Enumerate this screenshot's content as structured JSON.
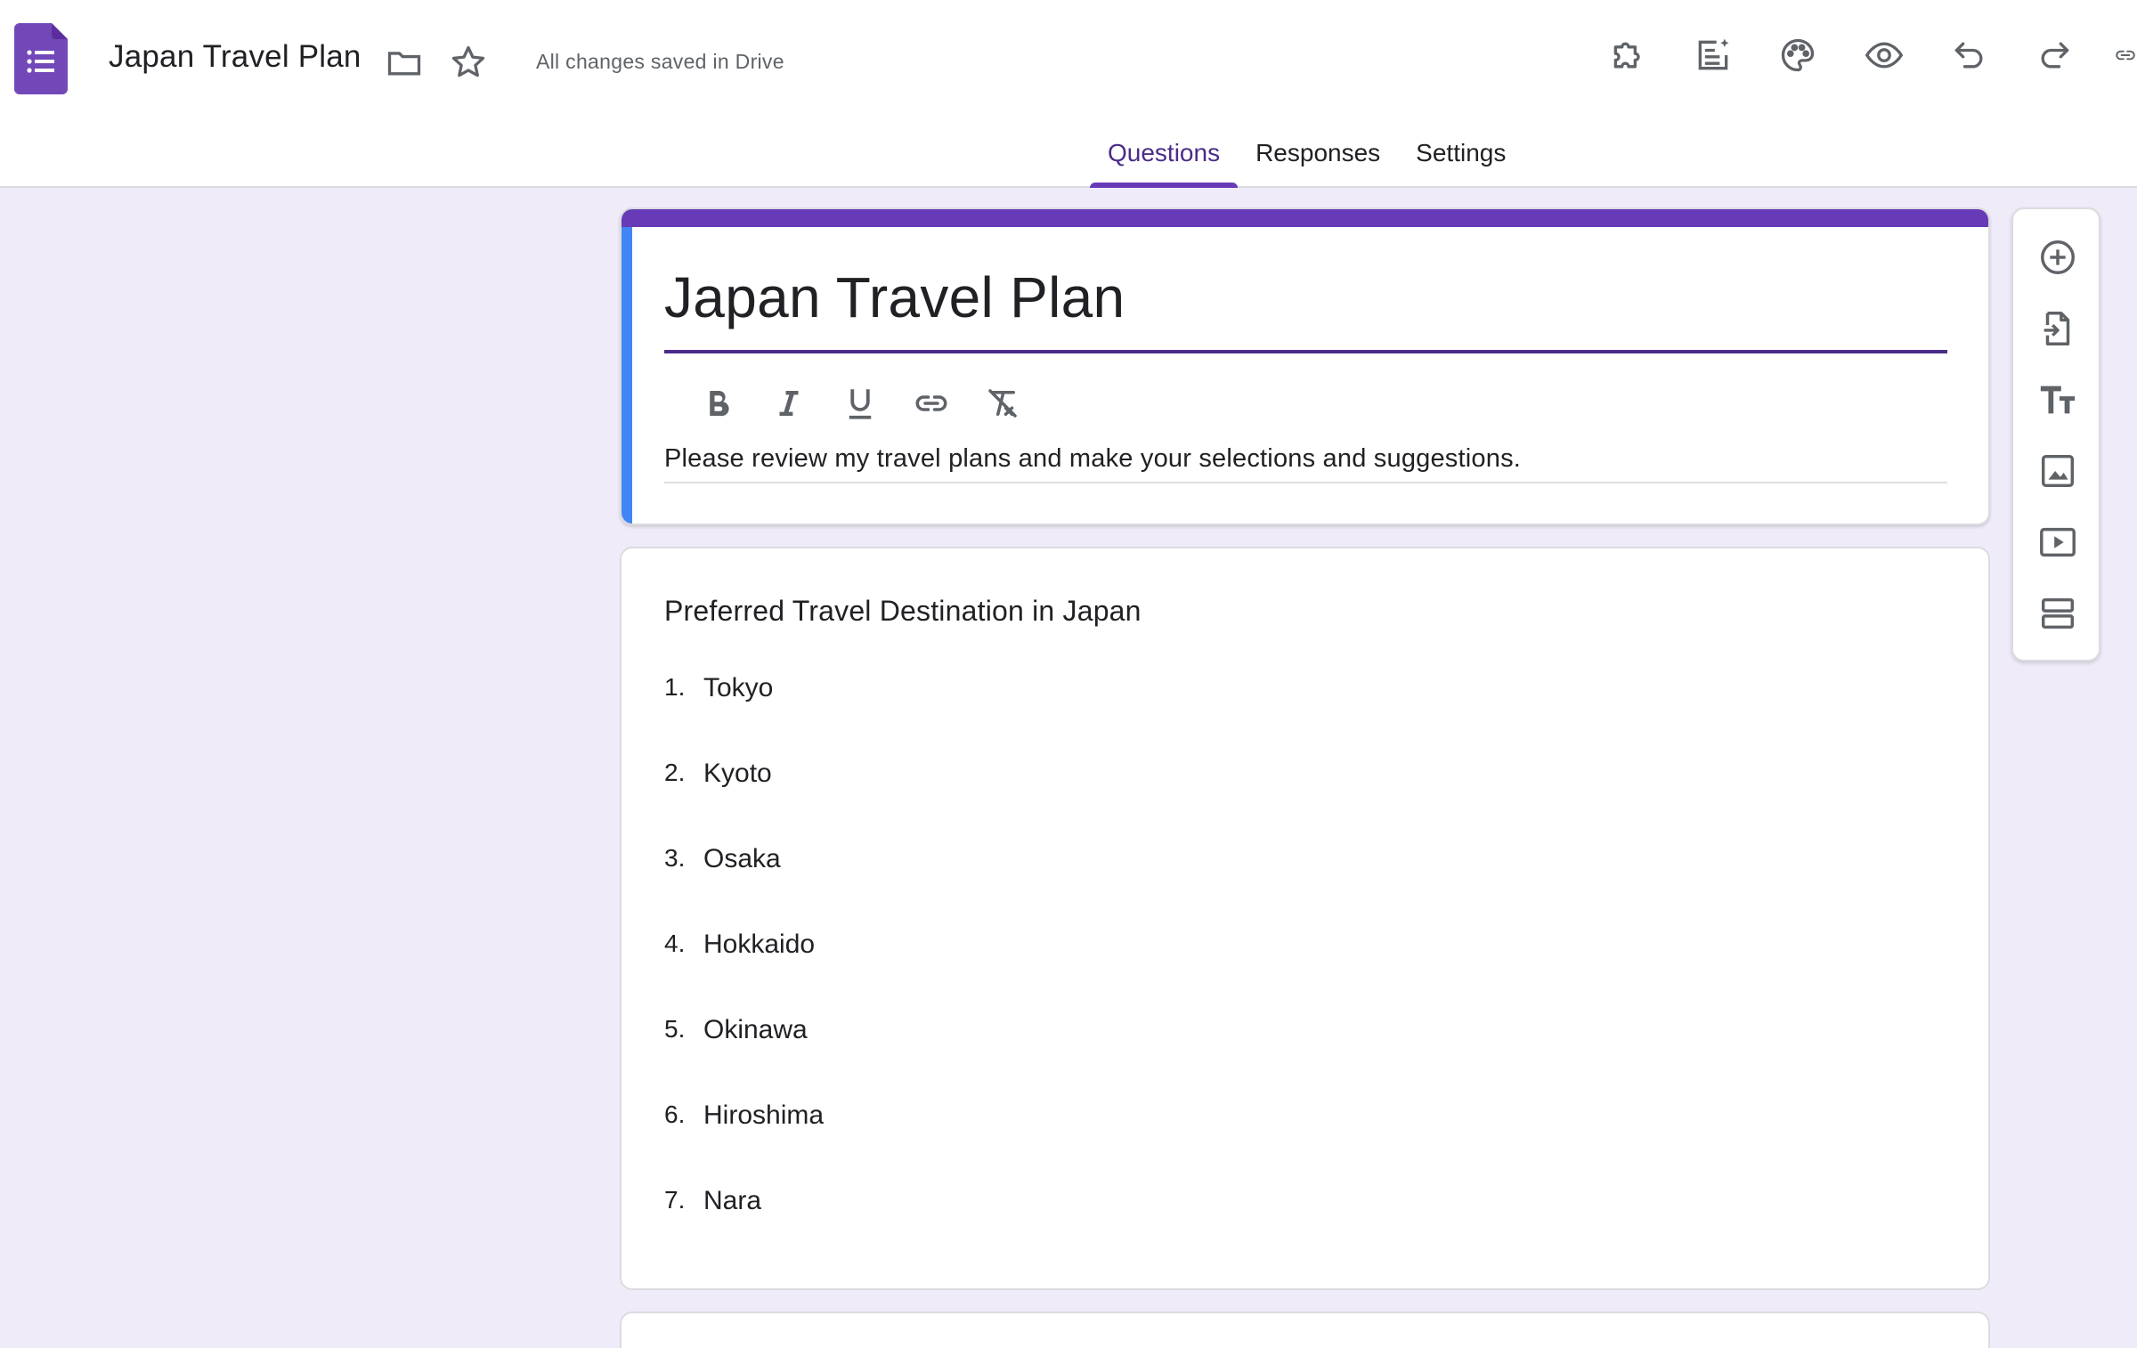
{
  "header": {
    "title": "Japan Travel Plan",
    "save_status": "All changes saved in Drive",
    "icons": [
      "forms-logo-icon",
      "folder-icon",
      "star-icon",
      "addon-puzzle-icon",
      "ai-forms-icon",
      "palette-icon",
      "preview-eye-icon",
      "undo-icon",
      "redo-icon",
      "link-icon"
    ]
  },
  "tabs": [
    {
      "label": "Questions",
      "active": true
    },
    {
      "label": "Responses",
      "active": false
    },
    {
      "label": "Settings",
      "active": false
    }
  ],
  "form": {
    "title": "Japan Travel Plan",
    "description": "Please review my travel plans and make your selections and suggestions.",
    "format_tools": [
      "bold-icon",
      "italic-icon",
      "underline-icon",
      "link-icon",
      "clear-format-icon"
    ]
  },
  "question": {
    "title": "Preferred Travel Destination in Japan",
    "options": [
      {
        "num": "1.",
        "label": "Tokyo"
      },
      {
        "num": "2.",
        "label": "Kyoto"
      },
      {
        "num": "3.",
        "label": "Osaka"
      },
      {
        "num": "4.",
        "label": "Hokkaido"
      },
      {
        "num": "5.",
        "label": "Okinawa"
      },
      {
        "num": "6.",
        "label": "Hiroshima"
      },
      {
        "num": "7.",
        "label": "Nara"
      }
    ]
  },
  "side_toolbar": [
    "add-question-icon",
    "import-questions-icon",
    "add-title-icon",
    "add-image-icon",
    "add-video-icon",
    "add-section-icon"
  ],
  "colors": {
    "accent": "#673ab7",
    "accent_dark": "#4a2c8a",
    "title_card_left_bar": "#4285f4",
    "background": "#f0ebf8",
    "icon_gray": "#5f6368"
  }
}
